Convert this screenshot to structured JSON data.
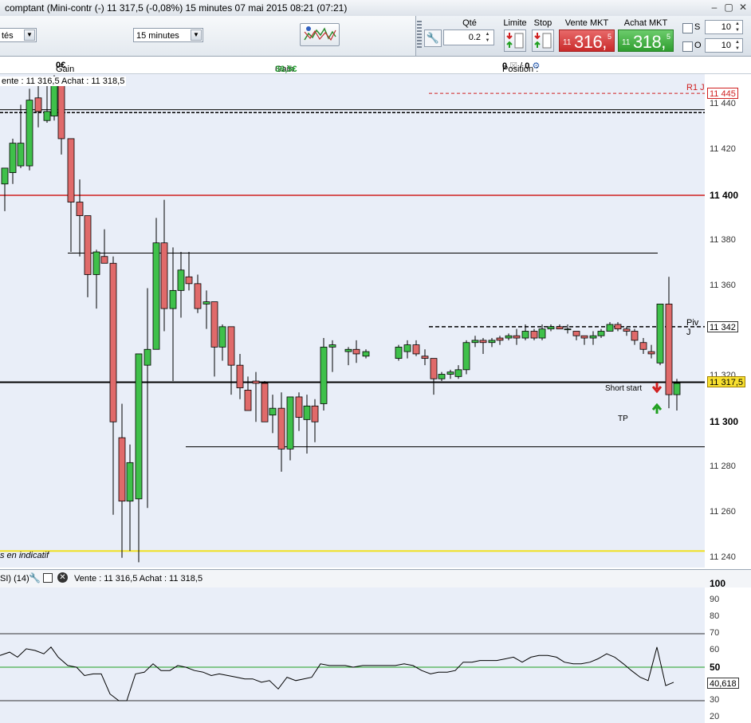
{
  "window": {
    "title": "comptant (Mini-contr (-)    11 317,5 (-0,08%)    15 minutes   07 mai 2015 08:21 (07:21)"
  },
  "toolbar": {
    "combo_left_value": "tés",
    "timeframe_value": "15 minutes",
    "qty_label": "Qté",
    "qty_value": "0.2",
    "limit_label": "Limite",
    "stop_label": "Stop",
    "sell_label": "Vente MKT",
    "buy_label": "Achat MKT",
    "sell_price_small": "11",
    "sell_price_big": "316,",
    "sell_price_sup": "5",
    "buy_price_small": "11",
    "buy_price_big": "318,",
    "buy_price_sup": "5",
    "s_label": "S",
    "o_label": "O",
    "s_value": "10",
    "o_value": "10"
  },
  "info": {
    "gain_latent_label": "Gain latent : ",
    "gain_latent_value": "0€",
    "gain_jour_label": "Gain Jour : ",
    "gain_jour_value": "36,5€",
    "position_label": "Position : ",
    "position_value_1": "0",
    "position_sep": "/",
    "position_value_2": "0"
  },
  "price_chart": {
    "ohlc_text": "ente : 11 316,5 Achat : 11 318,5",
    "bottom_text": "s en indicatif",
    "r1_label": "R1 J",
    "piv_label": "Piv J",
    "short_start_label": "Short start",
    "tp_label": "TP",
    "axis_ticks": [
      "11 440",
      "11 420",
      "11 400",
      "11 380",
      "11 360",
      "11 320",
      "11 300",
      "11 280",
      "11 260",
      "11 240"
    ],
    "bold_ticks": [
      "11 400",
      "11 300"
    ],
    "tag_r1": "11 445",
    "tag_piv": "11 342",
    "tag_last": "11 317,5",
    "colors": {
      "up": "#3fc04a",
      "down": "#e06a6a",
      "red_line": "#d02020",
      "yellow_line": "#f0e020",
      "bg": "#e9eef8"
    }
  },
  "rsi": {
    "header_name": "SI) (14)",
    "header_quote": "Vente : 11 316,5 Achat : 11 318,5",
    "axis_ticks": [
      "100",
      "90",
      "80",
      "70",
      "60",
      "50",
      "40",
      "30",
      "20"
    ],
    "tag_value": "40,618"
  }
}
